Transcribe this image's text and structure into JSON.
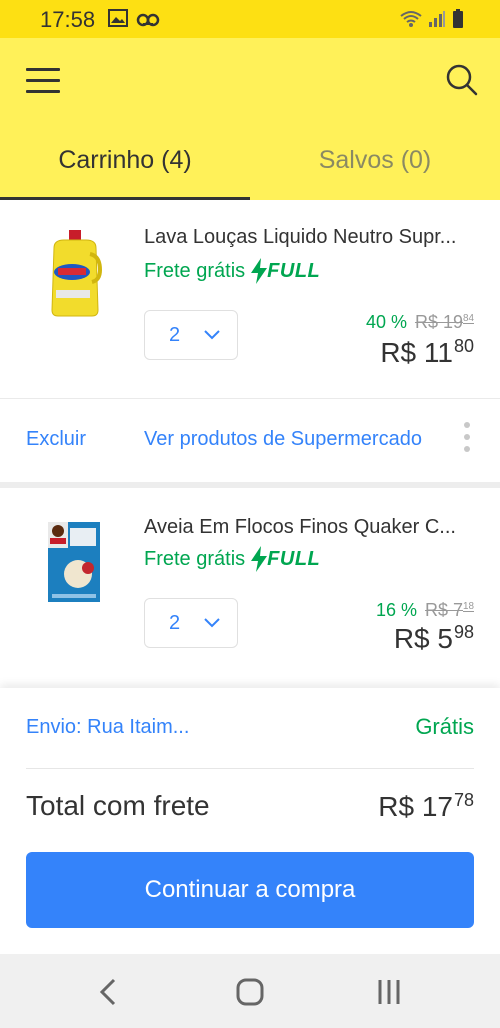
{
  "status_bar": {
    "time": "17:58",
    "icons_left": [
      "image-icon",
      "voicemail-icon"
    ],
    "icons_right": [
      "wifi-icon",
      "signal-icon",
      "battery-icon"
    ]
  },
  "header": {
    "menu_icon": "hamburger-menu-icon",
    "search_icon": "search-icon",
    "tabs": [
      {
        "label": "Carrinho (4)",
        "active": true
      },
      {
        "label": "Salvos (0)",
        "active": false
      }
    ]
  },
  "items": [
    {
      "title": "Lava Louças Liquido Neutro Supr...",
      "shipping_label": "Frete grátis",
      "badge": "FULL",
      "quantity": "2",
      "discount": "40 %",
      "old_price_main": "R$ 19",
      "old_price_cents": "84",
      "price_main": "R$ 11",
      "price_cents": "80"
    },
    {
      "title": "Aveia Em Flocos Finos Quaker C...",
      "shipping_label": "Frete grátis",
      "badge": "FULL",
      "quantity": "2",
      "discount": "16 %",
      "old_price_main": "R$ 7",
      "old_price_cents": "18",
      "price_main": "R$ 5",
      "price_cents": "98"
    }
  ],
  "item_actions": {
    "delete_label": "Excluir",
    "category_link": "Ver produtos de Supermercado"
  },
  "summary": {
    "shipping_address": "Envio: Rua Itaim...",
    "shipping_cost": "Grátis",
    "total_label": "Total com frete",
    "total_main": "R$ 17",
    "total_cents": "78",
    "continue_label": "Continuar a compra"
  },
  "colors": {
    "header_yellow": "#fff159",
    "accent_blue": "#3483fa",
    "success_green": "#00a650"
  },
  "nav_bar": {
    "buttons": [
      "back-icon",
      "home-icon",
      "recents-icon"
    ]
  }
}
